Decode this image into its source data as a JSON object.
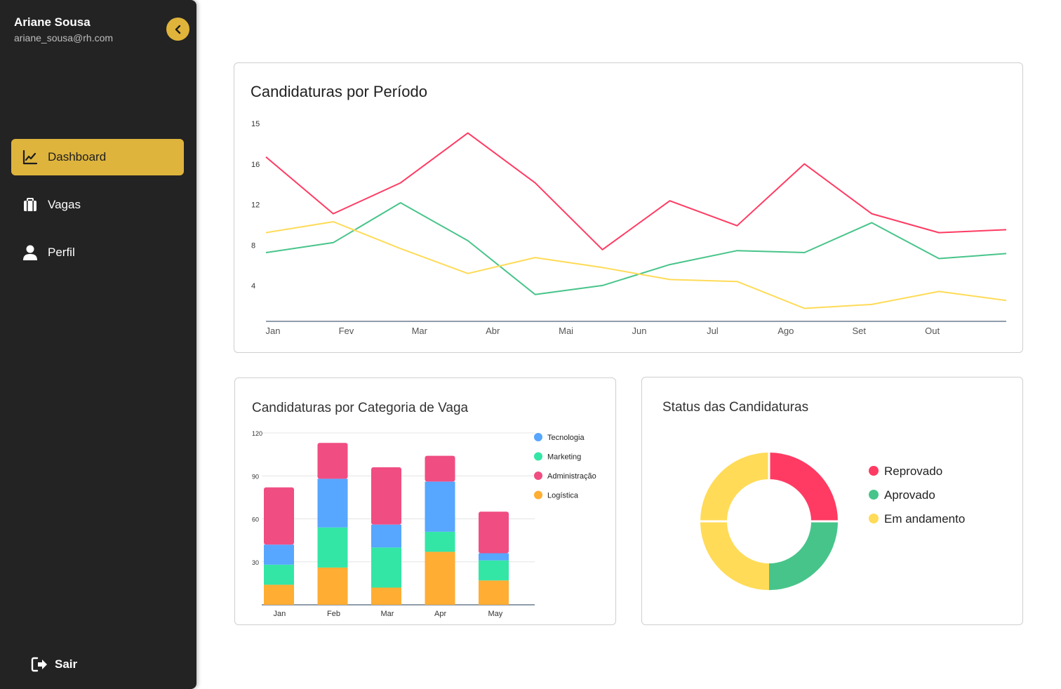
{
  "user": {
    "name": "Ariane Sousa",
    "email": "ariane_sousa@rh.com"
  },
  "nav": [
    {
      "label": "Dashboard",
      "icon": "chart-line-icon",
      "active": true
    },
    {
      "label": "Vagas",
      "icon": "briefcase-icon",
      "active": false
    },
    {
      "label": "Perfil",
      "icon": "user-icon",
      "active": false
    }
  ],
  "logout": {
    "label": "Sair",
    "icon": "logout-icon"
  },
  "colors": {
    "sidebar": "#232323",
    "accent": "#deb43d",
    "red": "#ff3b63",
    "green": "#47c48a",
    "yellow": "#ffdb57"
  },
  "chart_data": [
    {
      "type": "line",
      "title": "Candidaturas por Período",
      "categories": [
        "Jan",
        "Fev",
        "Mar",
        "Abr",
        "Mai",
        "Jun",
        "Jul",
        "Ago",
        "Set",
        "Out"
      ],
      "y_tick_labels": [
        "15",
        "16",
        "12",
        "8",
        "4"
      ],
      "ylim": [
        0,
        20
      ],
      "grid": false,
      "legend": "none",
      "series": [
        {
          "color": "#ff3b63",
          "values": [
            16.5,
            10.8,
            13.9,
            18.9,
            13.9,
            7.2,
            12.1,
            9.6,
            15.8,
            10.8,
            8.9,
            9.2
          ]
        },
        {
          "color": "#47c48a",
          "values": [
            6.9,
            7.9,
            11.9,
            8.1,
            2.7,
            3.6,
            5.7,
            7.1,
            6.9,
            9.9,
            6.3,
            6.8
          ]
        },
        {
          "color": "#ffdb57",
          "values": [
            8.9,
            10.0,
            7.3,
            4.8,
            6.4,
            5.4,
            4.2,
            4.0,
            1.3,
            1.7,
            3.0,
            2.1
          ]
        }
      ]
    },
    {
      "type": "bar",
      "stacked": true,
      "title": "Candidaturas por Categoria de Vaga",
      "categories": [
        "Jan",
        "Feb",
        "Mar",
        "Apr",
        "May"
      ],
      "y_ticks": [
        30,
        60,
        90,
        120
      ],
      "ylim": [
        0,
        120
      ],
      "legend": "top-right",
      "series": [
        {
          "name": "Logística",
          "color": "#ffad33",
          "values": [
            14,
            26,
            12,
            37,
            17
          ]
        },
        {
          "name": "Marketing",
          "color": "#33e6a6",
          "values": [
            14,
            28,
            28,
            14,
            14
          ]
        },
        {
          "name": "Tecnologia",
          "color": "#57a6ff",
          "values": [
            14,
            34,
            16,
            35,
            5
          ]
        },
        {
          "name": "Administração",
          "color": "#f04d82",
          "values": [
            40,
            25,
            40,
            18,
            29
          ]
        }
      ],
      "legend_order": [
        "Tecnologia",
        "Marketing",
        "Administração",
        "Logística"
      ]
    },
    {
      "type": "pie",
      "donut": true,
      "title": "Status das Candidaturas",
      "labels": [
        "Reprovado",
        "Aprovado",
        "Em andamento"
      ],
      "colors": [
        "#ff3b63",
        "#47c48a",
        "#ffdb57"
      ],
      "values": [
        25,
        25,
        50
      ]
    }
  ]
}
